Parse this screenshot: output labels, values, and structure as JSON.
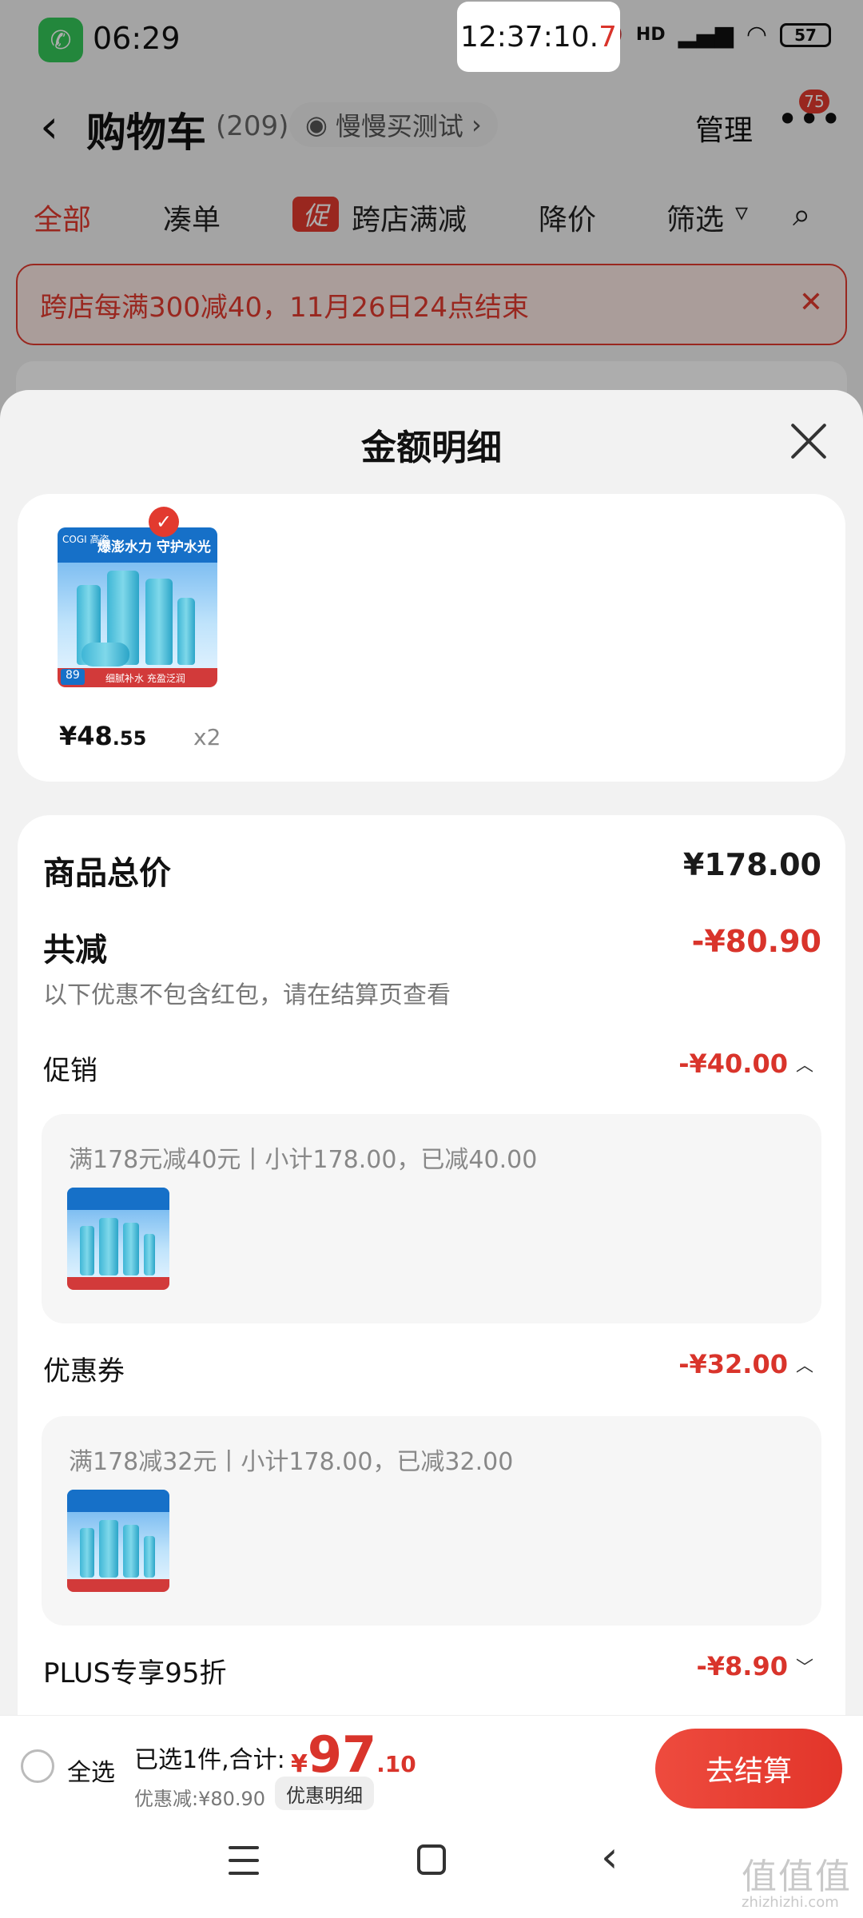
{
  "status_bar": {
    "time": "06:29",
    "clock_overlay": "12:37:10.",
    "clock_overlay_tenth": "7",
    "battery": "57",
    "hd_label": "HD"
  },
  "header": {
    "title": "购物车",
    "count": "(209)",
    "slow_buy": "慢慢买测试",
    "manage": "管理",
    "more_badge": "75"
  },
  "filters": {
    "all": "全部",
    "coudan": "凑单",
    "promo_tag": "促",
    "cross_store": "跨店满减",
    "price_drop": "降价",
    "filter": "筛选"
  },
  "notice": {
    "text": "跨店每满300减40，11月26日24点结束"
  },
  "sheet": {
    "title": "金额明细",
    "product": {
      "price_main": "¥48",
      "price_decimal": ".55",
      "quantity": "x2",
      "thumb_brand": "COGI 高姿",
      "thumb_banner": "爆澎水力 守护水光",
      "thumb_footer": "细腻补水 充盈泛润",
      "thumb_price": "89"
    },
    "total_label": "商品总价",
    "total_value": "¥178.00",
    "reduction_label": "共减",
    "reduction_value": "-¥80.90",
    "reduction_note": "以下优惠不包含红包，请在结算页查看",
    "promotion": {
      "label": "促销",
      "value": "-¥40.00",
      "detail": "满178元减40元丨小计178.00，已减40.00"
    },
    "coupon": {
      "label": "优惠券",
      "value": "-¥32.00",
      "detail": "满178减32元丨小计178.00，已减32.00"
    },
    "plus": {
      "label": "PLUS专享95折",
      "value": "-¥8.90"
    }
  },
  "checkout": {
    "select_all": "全选",
    "selected_text": "已选1件,合计:",
    "currency": "¥",
    "total_int": "97",
    "total_dec": ".10",
    "discount_text": "优惠减:¥80.90",
    "detail_pill": "优惠明细",
    "checkout_button": "去结算"
  },
  "watermark": {
    "text": "值值值",
    "url": "zhizhizhi.com"
  },
  "colors": {
    "accent_red": "#d9342b",
    "brand_red": "#e23a2f"
  }
}
